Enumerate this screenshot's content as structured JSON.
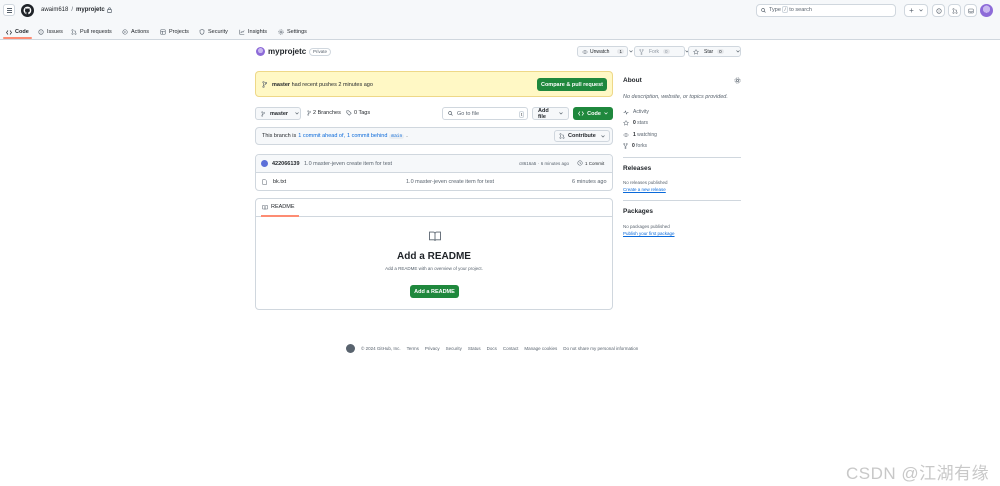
{
  "header": {
    "owner": "awaim618",
    "separator": "/",
    "repo": "myprojetc",
    "search_text": "Type",
    "search_key": "/",
    "search_suffix": "to search",
    "new_label": "+"
  },
  "tabs": [
    {
      "label": "Code"
    },
    {
      "label": "Issues"
    },
    {
      "label": "Pull requests"
    },
    {
      "label": "Actions"
    },
    {
      "label": "Projects"
    },
    {
      "label": "Security"
    },
    {
      "label": "Insights"
    },
    {
      "label": "Settings"
    }
  ],
  "repo_head": {
    "name": "myprojetc",
    "visibility": "Private",
    "unwatch_label": "Unwatch",
    "unwatch_count": "1",
    "fork_label": "Fork",
    "fork_count": "0",
    "star_label": "Star",
    "star_count": "0"
  },
  "banner": {
    "branch": "master",
    "text": "had recent pushes 2 minutes ago",
    "button": "Compare & pull request"
  },
  "toolbar": {
    "branch": "master",
    "branches": "2 Branches",
    "tags": "0 Tags",
    "goto_placeholder": "Go to file",
    "goto_key": "t",
    "add_file": "Add file",
    "code": "Code"
  },
  "ahead_bar": {
    "prefix": "This branch is",
    "ahead_link": "1 commit ahead of,",
    "behind_link": "1 commit behind",
    "base": "main",
    "suffix": ".",
    "contribute": "Contribute"
  },
  "commit": {
    "author": "422066139",
    "message": "1.0 master-jeven create item for test",
    "hash": "c8616a5",
    "time": "· 6 minutes ago",
    "count": "1 Commit"
  },
  "files": [
    {
      "name": "bk.txt",
      "message": "1.0 master-jeven create item for test",
      "time": "6 minutes ago"
    }
  ],
  "readme": {
    "tab": "README",
    "title": "Add a README",
    "desc": "Add a README with an overview of your project.",
    "button": "Add a README"
  },
  "about": {
    "title": "About",
    "desc": "No description, website, or topics provided.",
    "activity": "Activity",
    "stars_count": "0",
    "stars_label": "stars",
    "watching_count": "1",
    "watching_label": "watching",
    "forks_count": "0",
    "forks_label": "forks"
  },
  "releases": {
    "title": "Releases",
    "none": "No releases published",
    "link": "Create a new release"
  },
  "packages": {
    "title": "Packages",
    "none": "No packages published",
    "link": "Publish your first package"
  },
  "footer": {
    "copyright": "© 2024 GitHub, Inc.",
    "links": [
      "Terms",
      "Privacy",
      "Security",
      "Status",
      "Docs",
      "Contact",
      "Manage cookies",
      "Do not share my personal information"
    ]
  },
  "watermark": "CSDN @江湖有缘",
  "colors": {
    "accent_green": "#1f883d",
    "link_blue": "#0969da",
    "tab_underline": "#fd8c73",
    "banner_bg": "#fff8c5"
  }
}
